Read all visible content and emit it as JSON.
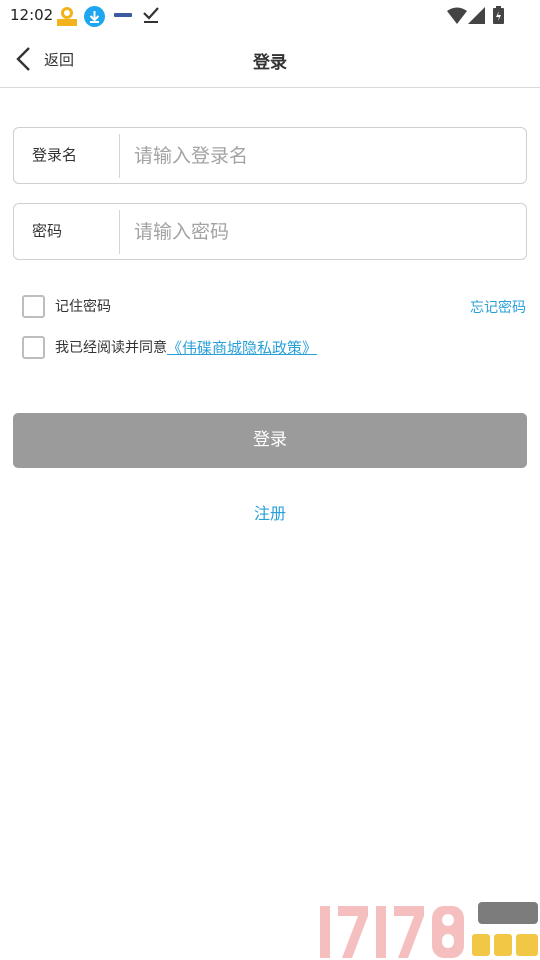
{
  "status_bar": {
    "time": "12:02",
    "icons": [
      "app-icon",
      "download-icon",
      "notification-icon",
      "check-icon",
      "wifi-icon",
      "signal-icon",
      "battery-icon"
    ]
  },
  "header": {
    "back_label": "返回",
    "title": "登录"
  },
  "form": {
    "username": {
      "label": "登录名",
      "placeholder": "请输入登录名",
      "value": ""
    },
    "password": {
      "label": "密码",
      "placeholder": "请输入密码",
      "value": ""
    }
  },
  "options": {
    "remember_label": "记住密码",
    "remember_checked": false,
    "forgot_label": "忘记密码",
    "agree_prefix": "我已经阅读并同意",
    "policy_label": "《伟碟商城隐私政策》",
    "agree_checked": false
  },
  "actions": {
    "login_label": "登录",
    "register_label": "注册"
  },
  "colors": {
    "accent": "#2aa0d8",
    "login_button": "#9b9b9b",
    "border": "#cfcfcf"
  }
}
